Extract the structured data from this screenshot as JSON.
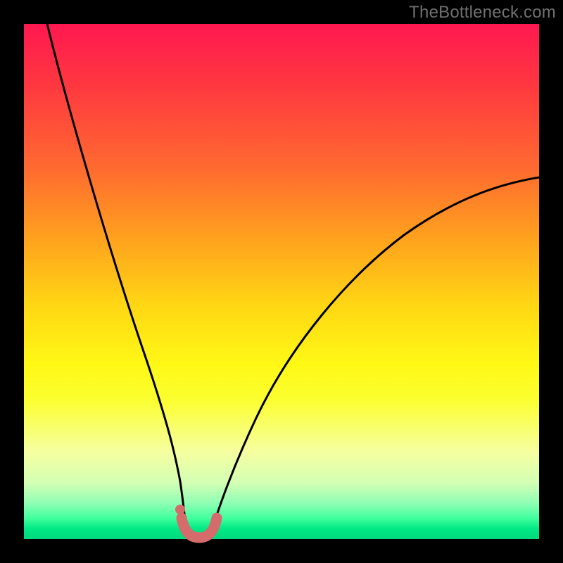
{
  "watermark": "TheBottleneck.com",
  "colors": {
    "frame_background": "#000000",
    "curve_stroke": "#000000",
    "marker_stroke": "#d66b6b",
    "marker_fill": "#d66b6b",
    "watermark_text": "#6f6f6f"
  },
  "chart_data": {
    "type": "line",
    "title": "",
    "xlabel": "",
    "ylabel": "",
    "xlim": [
      0,
      100
    ],
    "ylim": [
      0,
      100
    ],
    "grid": false,
    "legend": false,
    "gradient_stops": [
      {
        "pos": 0,
        "color": "#ff1850"
      },
      {
        "pos": 12,
        "color": "#ff3840"
      },
      {
        "pos": 28,
        "color": "#ff6a30"
      },
      {
        "pos": 42,
        "color": "#ffa31d"
      },
      {
        "pos": 55,
        "color": "#ffd814"
      },
      {
        "pos": 66,
        "color": "#fff815"
      },
      {
        "pos": 73,
        "color": "#fbff30"
      },
      {
        "pos": 83,
        "color": "#f6ffa0"
      },
      {
        "pos": 89,
        "color": "#d4ffb4"
      },
      {
        "pos": 93,
        "color": "#8fffb4"
      },
      {
        "pos": 96,
        "color": "#3fff9c"
      },
      {
        "pos": 98,
        "color": "#00e884"
      },
      {
        "pos": 100,
        "color": "#00d97e"
      }
    ],
    "series": [
      {
        "name": "bottleneck-curve-left",
        "x": [
          4.5,
          7,
          10,
          14,
          18,
          22,
          25,
          27,
          28.5,
          30,
          31.5
        ],
        "y": [
          100,
          90,
          78,
          62,
          46,
          30,
          18,
          11,
          7,
          3.5,
          1.5
        ]
      },
      {
        "name": "bottleneck-curve-right",
        "x": [
          36.5,
          38,
          40,
          44,
          50,
          58,
          66,
          74,
          82,
          90,
          100
        ],
        "y": [
          1.5,
          4,
          8,
          16,
          27,
          38,
          47,
          54,
          60,
          65,
          70
        ]
      },
      {
        "name": "optimal-floor",
        "x": [
          31.5,
          32.5,
          34,
          35.5,
          36.5
        ],
        "y": [
          1.5,
          0.8,
          0.6,
          0.8,
          1.5
        ]
      }
    ],
    "markers": {
      "floor_band": {
        "x": [
          31,
          32,
          33,
          34,
          35,
          36,
          37
        ],
        "y": [
          2.0,
          1.0,
          0.7,
          0.6,
          0.7,
          1.0,
          2.0
        ]
      },
      "dot": {
        "x": 30.5,
        "y": 5.5
      }
    }
  }
}
